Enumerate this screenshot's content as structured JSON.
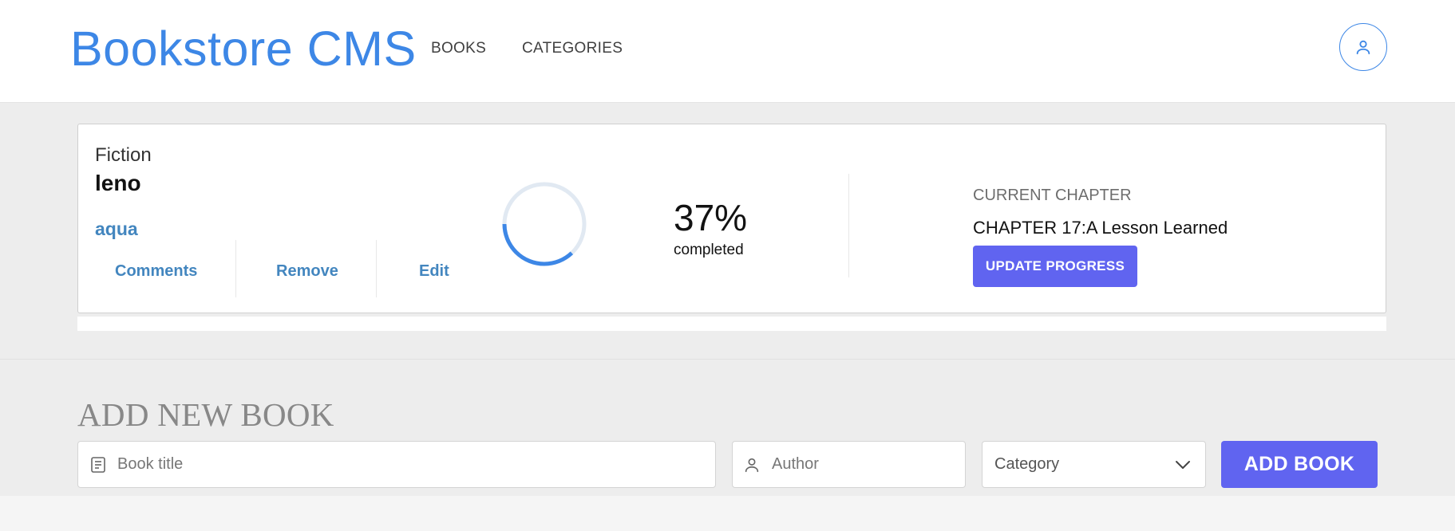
{
  "header": {
    "brand": "Bookstore CMS",
    "nav": [
      {
        "label": "BOOKS"
      },
      {
        "label": "CATEGORIES"
      }
    ],
    "user_icon": "user-icon"
  },
  "book": {
    "genre": "Fiction",
    "title": "leno",
    "author": "aqua",
    "actions": {
      "comments": "Comments",
      "remove": "Remove",
      "edit": "Edit"
    },
    "progress": {
      "percent_label": "37%",
      "value": 0.37,
      "completed_label": "completed"
    },
    "chapter": {
      "label": "CURRENT CHAPTER",
      "name": "CHAPTER 17:A Lesson Learned",
      "button": "UPDATE PROGRESS"
    }
  },
  "add_form": {
    "heading": "ADD NEW BOOK",
    "title_placeholder": "Book title",
    "author_placeholder": "Author",
    "category_selected": "Category",
    "submit_label": "ADD BOOK",
    "icons": {
      "title": "book-icon",
      "author": "user-icon",
      "category": "chevron-down-icon"
    }
  },
  "colors": {
    "brand": "#3d87e6",
    "accent": "#6064f0",
    "link": "#4386bf",
    "progress_track": "#e1e9f2"
  }
}
